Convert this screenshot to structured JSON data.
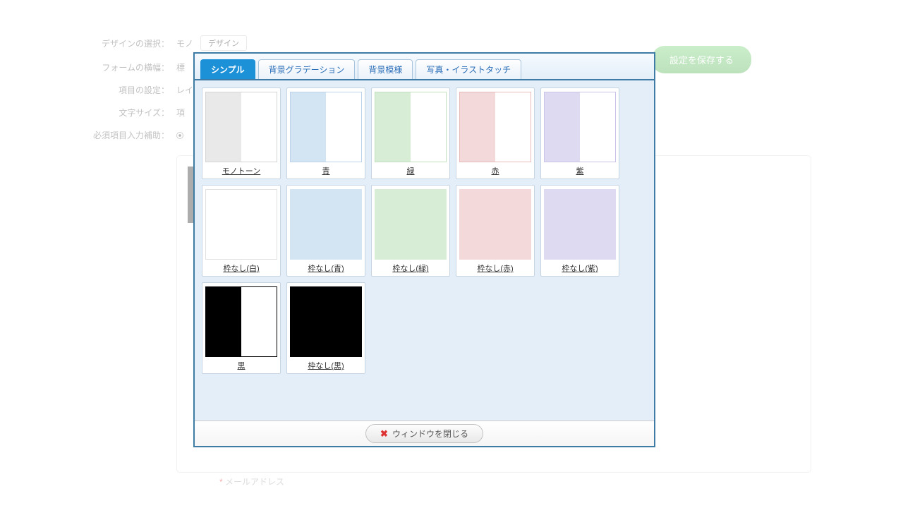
{
  "bg_form": {
    "rows": [
      {
        "label": "デザインの選択：",
        "value": "モノ",
        "btn": "デザイン"
      },
      {
        "label": "フォームの横幅：",
        "value": "標"
      },
      {
        "label": "項目の設定：",
        "value": "レイ"
      },
      {
        "label": "文字サイズ：",
        "value": "項"
      },
      {
        "label": "必須項目入力補助：",
        "value": ""
      }
    ],
    "save_btn": "設定を保存する",
    "mail_label": "メールアドレス"
  },
  "modal": {
    "tabs": [
      {
        "label": "シンプル",
        "active": true
      },
      {
        "label": "背景グラデーション",
        "active": false
      },
      {
        "label": "背景模様",
        "active": false
      },
      {
        "label": "写真・イラストタッチ",
        "active": false
      }
    ],
    "themes": [
      {
        "label": "モノトーン",
        "left": "#e9e9e9",
        "right": "#ffffff",
        "border": "#d5d5d5"
      },
      {
        "label": "青",
        "left": "#d3e4f3",
        "right": "#ffffff",
        "border": "#bcd3ea"
      },
      {
        "label": "緑",
        "left": "#d8edd6",
        "right": "#ffffff",
        "border": "#c2e0bf"
      },
      {
        "label": "赤",
        "left": "#f3d9d9",
        "right": "#ffffff",
        "border": "#e8baba"
      },
      {
        "label": "紫",
        "left": "#dedaf2",
        "right": "#ffffff",
        "border": "#c9c3e8"
      },
      {
        "label": "枠なし(白)",
        "left": "#ffffff",
        "right": "#ffffff",
        "border": "#e0e0e0"
      },
      {
        "label": "枠なし(青)",
        "left": "#d3e4f3",
        "right": "#d3e4f3",
        "border": "#d3e4f3"
      },
      {
        "label": "枠なし(緑)",
        "left": "#d8edd6",
        "right": "#d8edd6",
        "border": "#d8edd6"
      },
      {
        "label": "枠なし(赤)",
        "left": "#f3d9d9",
        "right": "#f3d9d9",
        "border": "#f3d9d9"
      },
      {
        "label": "枠なし(紫)",
        "left": "#dedaf2",
        "right": "#dedaf2",
        "border": "#dedaf2"
      },
      {
        "label": "黒",
        "left": "#000000",
        "right": "#ffffff",
        "border": "#000000"
      },
      {
        "label": "枠なし(黒)",
        "left": "#000000",
        "right": "#000000",
        "border": "#000000"
      }
    ],
    "close_btn": "ウィンドウを閉じる"
  }
}
